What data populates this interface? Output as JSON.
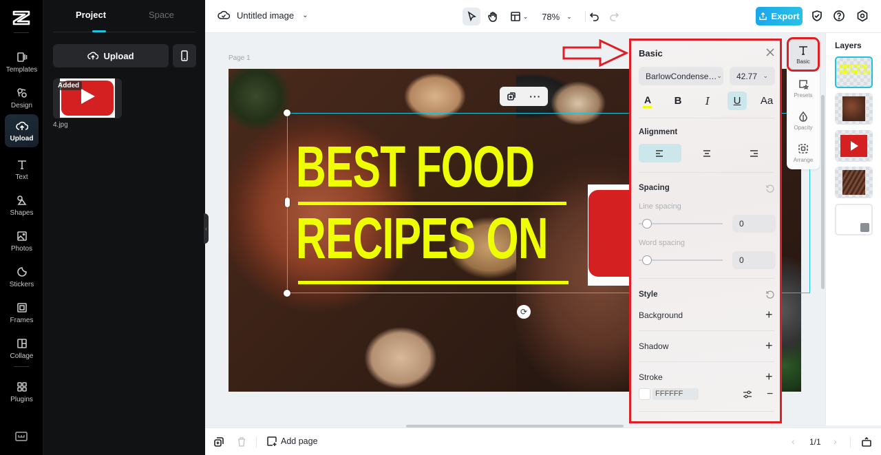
{
  "rail": {
    "items": [
      {
        "label": "Templates",
        "icon": "templates-icon"
      },
      {
        "label": "Design",
        "icon": "design-icon"
      },
      {
        "label": "Upload",
        "icon": "upload-cloud-icon",
        "active": true
      },
      {
        "label": "Text",
        "icon": "text-icon"
      },
      {
        "label": "Shapes",
        "icon": "shapes-icon"
      },
      {
        "label": "Photos",
        "icon": "photos-icon"
      },
      {
        "label": "Stickers",
        "icon": "stickers-icon"
      },
      {
        "label": "Frames",
        "icon": "frames-icon"
      },
      {
        "label": "Collage",
        "icon": "collage-icon"
      },
      {
        "label": "Plugins",
        "icon": "plugins-icon"
      }
    ]
  },
  "panel": {
    "tabs": [
      "Project",
      "Space"
    ],
    "active_tab": "Project",
    "upload_label": "Upload",
    "asset": {
      "badge": "Added",
      "name": "4.jpg"
    }
  },
  "topbar": {
    "title": "Untitled image",
    "zoom": "78%",
    "export_label": "Export"
  },
  "canvas": {
    "page_label": "Page 1",
    "headline_line1": "BEST FOOD",
    "headline_line2": "RECIPES ON"
  },
  "basic_panel": {
    "title": "Basic",
    "font_family": "BarlowCondense…",
    "font_size": "42.77",
    "text_color": "#EEFF00",
    "format_buttons": {
      "color": "A",
      "bold": "B",
      "italic": "I",
      "underline": "U",
      "case": "Aa"
    },
    "underline_active": true,
    "alignment_label": "Alignment",
    "alignment_active": "left",
    "spacing_label": "Spacing",
    "line_spacing_label": "Line spacing",
    "line_spacing_value": "0",
    "word_spacing_label": "Word spacing",
    "word_spacing_value": "0",
    "style_label": "Style",
    "background_label": "Background",
    "shadow_label": "Shadow",
    "stroke_label": "Stroke",
    "stroke_color": "FFFFFF"
  },
  "mini_toolbar": {
    "items": [
      "Basic",
      "Presets",
      "Opacity",
      "Arrange"
    ],
    "active": "Basic"
  },
  "layers": {
    "title": "Layers",
    "thumb_text": "BEST FOOD RECIPES ON"
  },
  "bottombar": {
    "add_page_label": "Add page",
    "pager": "1/1"
  },
  "colors": {
    "accent": "#1FC2D8",
    "annotation": "#E01E26",
    "headline": "#EEFF00",
    "export": "#1AA7EC"
  }
}
